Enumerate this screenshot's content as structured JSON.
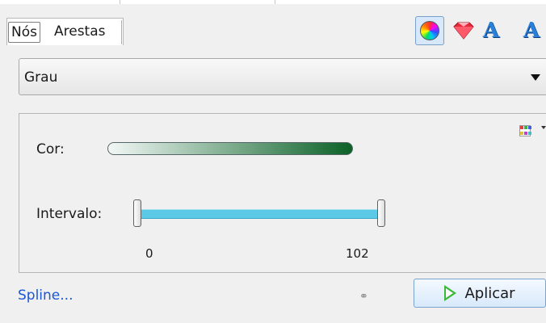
{
  "tabs": [
    {
      "label": "Nós",
      "active": true
    },
    {
      "label": "Arestas",
      "active": false
    }
  ],
  "toolbar": {
    "icons": [
      "color-wheel-icon",
      "gem-icon",
      "label-size-icon",
      "label-color-icon"
    ],
    "selected": "color-wheel-icon",
    "letter_glyph": "A"
  },
  "attribute_select": {
    "value": "Grau"
  },
  "ranking": {
    "color_label": "Cor:",
    "gradient": {
      "start": "#f2f8f6",
      "end": "#0b6127"
    },
    "interval_label": "Intervalo:",
    "range_min": "0",
    "range_max": "102",
    "range_fill": 1.0,
    "track_color": "#5ccae6"
  },
  "footer": {
    "spline_link": "Spline...",
    "apply_label": "Aplicar",
    "accent": "#1a56d6"
  }
}
